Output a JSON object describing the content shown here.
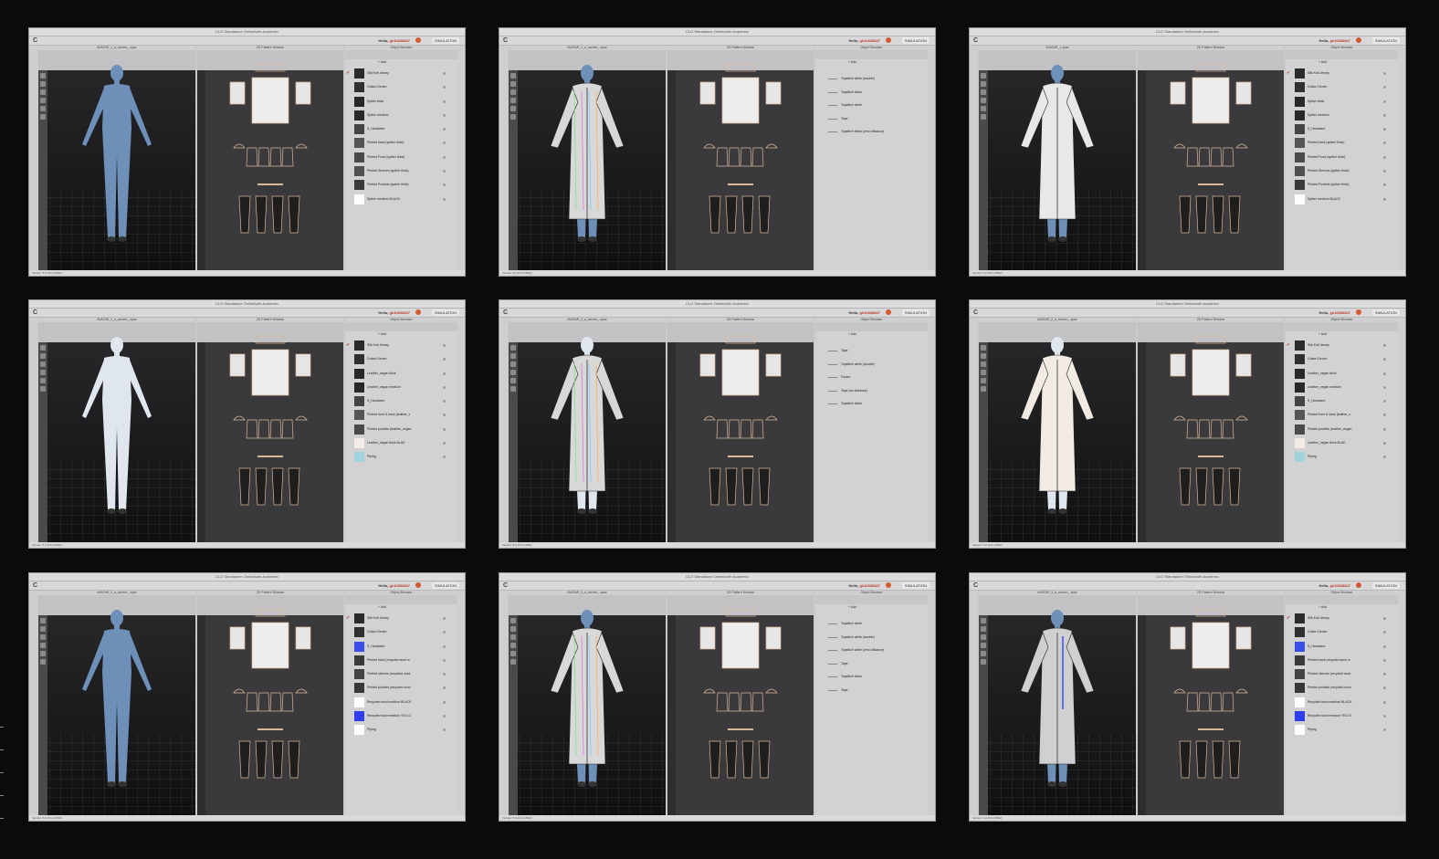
{
  "app": {
    "window_title": "CLO Standalone OnlineAuth Academic",
    "user_prefix": "Hello,",
    "user_name": "gk10838847",
    "simulation": "SIMULATION",
    "pattern_window": "2D Pattern Window",
    "object_browser": "Object Browser",
    "add": "+ Add",
    "version": "Version: 5.0.104 (x3992)"
  },
  "colors": {
    "accent": "#c0392b",
    "bg": "#0b0b0d"
  },
  "windows": [
    {
      "file": "AVATAR_1_a_screen_.zpac",
      "avatar": "blue",
      "garment": "none",
      "fabrics": [
        {
          "name": "Silk Knit Jersey",
          "color": "#2b2b2b",
          "check": true
        },
        {
          "name": "Cotton Denim",
          "color": "#303030"
        },
        {
          "name": "Spiber thick",
          "color": "#2a2826"
        },
        {
          "name": "Spiber medium",
          "color": "#2a2826"
        },
        {
          "name": "S_Hardware",
          "color": "#444"
        },
        {
          "name": "Printed back (spiber thick)",
          "color": "#555"
        },
        {
          "name": "Printed Front (spiber thick)",
          "color": "#4a4a4a"
        },
        {
          "name": "Printed Sleeves (spiber thick)",
          "color": "#505050"
        },
        {
          "name": "Printed Pockets (spiber thick)",
          "color": "#3a3a3a"
        },
        {
          "name": "Spiber medium BLACK",
          "color": "#ffffff"
        }
      ]
    },
    {
      "file": "AVATAR_1_a_screen_.zpac",
      "avatar": "blue",
      "garment": "coat-wire",
      "trims": [
        "Topstitch white (double)",
        "Topstitch black",
        "Topstitch white",
        "Tape",
        "Topstitch black (zero distance)"
      ]
    },
    {
      "file": "AVATAR_1.zpac",
      "avatar": "blue",
      "garment": "coat-print",
      "fabrics": [
        {
          "name": "Silk Knit Jersey",
          "color": "#2b2b2b",
          "check": true
        },
        {
          "name": "Cotton Denim",
          "color": "#303030"
        },
        {
          "name": "Spiber thick",
          "color": "#2a2826"
        },
        {
          "name": "Spiber medium",
          "color": "#2a2826"
        },
        {
          "name": "S_Hardware",
          "color": "#444"
        },
        {
          "name": "Printed back (spiber thick)",
          "color": "#555"
        },
        {
          "name": "Printed Front (spiber thick)",
          "color": "#4a4a4a"
        },
        {
          "name": "Printed Sleeves (spiber thick)",
          "color": "#505050"
        },
        {
          "name": "Printed Pockets (spiber thick)",
          "color": "#3a3a3a"
        },
        {
          "name": "Spiber medium BLACK",
          "color": "#ffffff"
        }
      ]
    },
    {
      "file": "AVATAR_2_a_screen_.zpac",
      "avatar": "white",
      "garment": "none",
      "fabrics": [
        {
          "name": "Silk Knit Jersey",
          "color": "#2b2b2b",
          "check": true
        },
        {
          "name": "Cotton Denim",
          "color": "#303030"
        },
        {
          "name": "Leather_vegan thick",
          "color": "#2a2826"
        },
        {
          "name": "Leather_vegan medium",
          "color": "#2a2826"
        },
        {
          "name": "S_Hardware",
          "color": "#444"
        },
        {
          "name": "Printed front & back (leather_v",
          "color": "#555"
        },
        {
          "name": "Printed pockets (leather_vegan",
          "color": "#4a4a4a"
        },
        {
          "name": "Leather_vegan thick BLUE",
          "color": "#f3ece6"
        },
        {
          "name": "Piping",
          "color": "#9fd4dc"
        }
      ]
    },
    {
      "file": "AVATAR_2_a_screen_.zpac",
      "avatar": "white",
      "garment": "coat-wire",
      "trims": [
        "Tape",
        "Topstitch white (double)",
        "Fusion",
        "Tape (no distance)",
        "Topstitch black"
      ]
    },
    {
      "file": "AVATAR_2_a_screen_.zpac",
      "avatar": "white",
      "garment": "coat-light",
      "fabrics": [
        {
          "name": "Silk Knit Jersey",
          "color": "#2b2b2b",
          "check": true
        },
        {
          "name": "Cotton Denim",
          "color": "#303030"
        },
        {
          "name": "Leather_vegan thick",
          "color": "#2a2826"
        },
        {
          "name": "Leather_vegan medium",
          "color": "#2a2826"
        },
        {
          "name": "S_Hardware",
          "color": "#444"
        },
        {
          "name": "Printed front & back (leather_v",
          "color": "#555"
        },
        {
          "name": "Printed pockets (leather_vegan",
          "color": "#4a4a4a"
        },
        {
          "name": "Leather_vegan thick BLUE",
          "color": "#f3ece6"
        },
        {
          "name": "Piping",
          "color": "#9fd4dc"
        }
      ]
    },
    {
      "file": "AVATAR_3_a_screen_.zpac",
      "avatar": "blue",
      "garment": "none",
      "fabrics": [
        {
          "name": "Silk Knit Jersey",
          "color": "#2b2b2b",
          "check": true
        },
        {
          "name": "Cotton Denim",
          "color": "#303030"
        },
        {
          "name": "S_Hardware",
          "color": "#3b4fe8"
        },
        {
          "name": "Printed back (recycled wool m",
          "color": "#3a3a3a"
        },
        {
          "name": "Printed sleeves (recycled wool",
          "color": "#444"
        },
        {
          "name": "Printed pockets (recycled wool",
          "color": "#383838"
        },
        {
          "name": "Recycled wool medium BLACK",
          "color": "#ffffff"
        },
        {
          "name": "Recycled wool medium YELLO",
          "color": "#2f3ef0"
        },
        {
          "name": "Piping",
          "color": "#ffffff"
        }
      ]
    },
    {
      "file": "AVATAR_3_a_screen_.zpac",
      "avatar": "blue",
      "garment": "coat-wire",
      "trims": [
        "Topstitch white",
        "Topstitch white (double)",
        "Topstitch white (zero distance)",
        "Tape",
        "Topstitch black",
        "Tape"
      ]
    },
    {
      "file": "AVATAR_3_a_screen_.zpac",
      "avatar": "blue",
      "garment": "coat-check",
      "fabrics": [
        {
          "name": "Silk Knit Jersey",
          "color": "#2b2b2b",
          "check": true
        },
        {
          "name": "Cotton Denim",
          "color": "#303030"
        },
        {
          "name": "S_Hardware",
          "color": "#3b4fe8"
        },
        {
          "name": "Printed back (recycled wool m",
          "color": "#3a3a3a"
        },
        {
          "name": "Printed sleeves (recycled wool",
          "color": "#444"
        },
        {
          "name": "Printed pockets (recycled wool",
          "color": "#383838"
        },
        {
          "name": "Recycled wool medium BLACK",
          "color": "#ffffff"
        },
        {
          "name": "Recycled wool medium YELLO",
          "color": "#2f3ef0"
        },
        {
          "name": "Piping",
          "color": "#ffffff"
        }
      ]
    }
  ]
}
